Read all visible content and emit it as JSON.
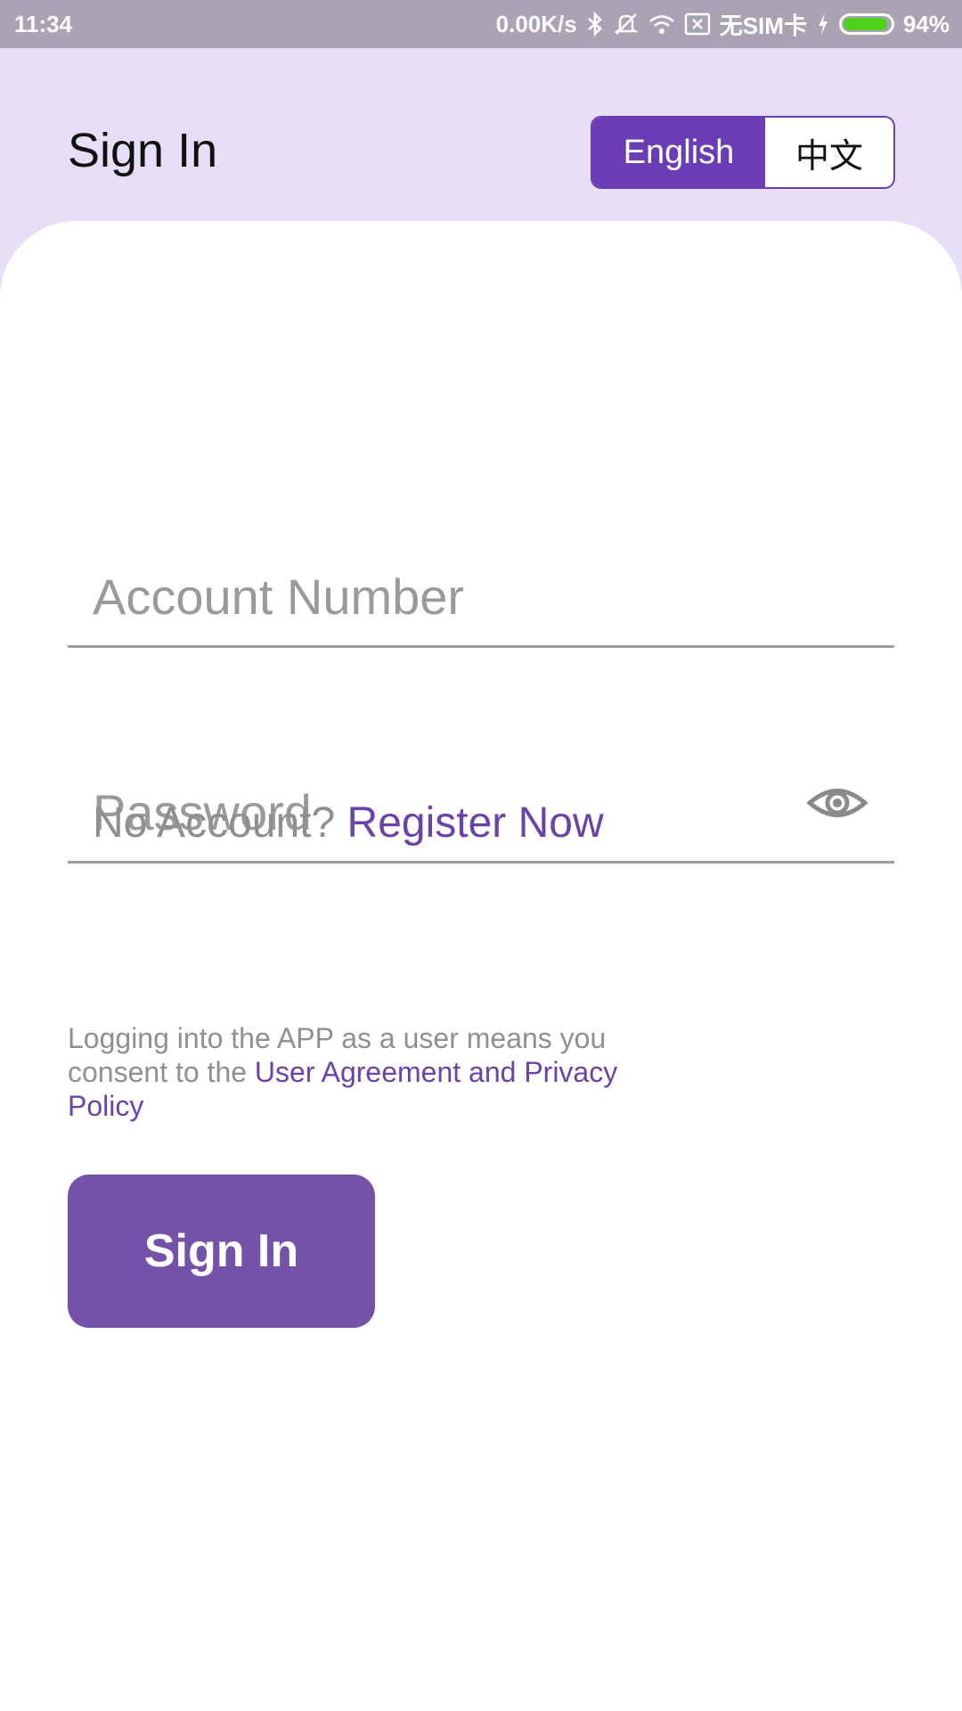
{
  "status_bar": {
    "time": "11:34",
    "network_speed": "0.00K/s",
    "sim_status": "无SIM卡",
    "battery_percent": "94%",
    "battery_level": 0.94,
    "icons": [
      "bluetooth-icon",
      "mute-icon",
      "wifi-icon",
      "sim-blocked-icon",
      "charging-icon",
      "battery-icon"
    ]
  },
  "header": {
    "title": "Sign In",
    "language_toggle": {
      "options": [
        "English",
        "中文"
      ],
      "selected": "English"
    }
  },
  "form": {
    "account_placeholder": "Account Number",
    "account_value": "",
    "password_placeholder": "Password",
    "password_value": "",
    "password_visibility_icon": "eye-icon"
  },
  "register": {
    "prompt": "No Account?",
    "link": "Register Now"
  },
  "agreement": {
    "text": "Logging into the APP as a user means you consent to the ",
    "link": "User Agreement and Privacy Policy"
  },
  "actions": {
    "sign_in_label": "Sign In"
  },
  "colors": {
    "accent": "#6a3db5",
    "button": "#7452a8",
    "header_bg": "#e7def7",
    "status_bar_bg": "#a9a3b4",
    "battery_fill": "#4fd01b"
  }
}
